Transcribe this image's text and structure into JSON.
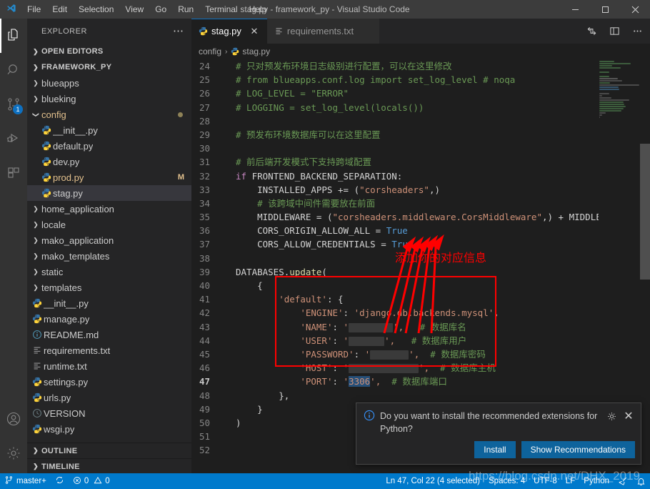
{
  "window": {
    "title": "stag.py - framework_py - Visual Studio Code",
    "minimize": "—",
    "maximize": "☐",
    "close": "✕"
  },
  "menu": {
    "items": [
      "File",
      "Edit",
      "Selection",
      "View",
      "Go",
      "Run",
      "Terminal",
      "Help"
    ]
  },
  "activity_bar": {
    "items": [
      {
        "name": "explorer-icon",
        "badge": ""
      },
      {
        "name": "search-icon",
        "badge": ""
      },
      {
        "name": "source-control-icon",
        "badge": "1"
      },
      {
        "name": "run-debug-icon",
        "badge": ""
      },
      {
        "name": "extensions-icon",
        "badge": ""
      }
    ],
    "bottom_items": [
      {
        "name": "account-icon"
      },
      {
        "name": "settings-gear-icon"
      }
    ]
  },
  "sidebar": {
    "header": "EXPLORER",
    "more_actions": "⋯",
    "sections": [
      {
        "label": "OPEN EDITORS",
        "expanded": false
      },
      {
        "label": "FRAMEWORK_PY",
        "expanded": true
      }
    ],
    "tree": [
      {
        "label": "blueapps",
        "type": "folder",
        "depth": 1,
        "expanded": false
      },
      {
        "label": "blueking",
        "type": "folder",
        "depth": 1,
        "expanded": false
      },
      {
        "label": "config",
        "type": "folder",
        "depth": 1,
        "expanded": true,
        "modified_dot": true
      },
      {
        "label": "__init__.py",
        "type": "python",
        "depth": 2
      },
      {
        "label": "default.py",
        "type": "python",
        "depth": 2
      },
      {
        "label": "dev.py",
        "type": "python",
        "depth": 2
      },
      {
        "label": "prod.py",
        "type": "python",
        "depth": 2,
        "badge": "M",
        "modified": true
      },
      {
        "label": "stag.py",
        "type": "python",
        "depth": 2,
        "selected": true
      },
      {
        "label": "home_application",
        "type": "folder",
        "depth": 1,
        "expanded": false
      },
      {
        "label": "locale",
        "type": "folder",
        "depth": 1,
        "expanded": false
      },
      {
        "label": "mako_application",
        "type": "folder",
        "depth": 1,
        "expanded": false
      },
      {
        "label": "mako_templates",
        "type": "folder",
        "depth": 1,
        "expanded": false
      },
      {
        "label": "static",
        "type": "folder",
        "depth": 1,
        "expanded": false
      },
      {
        "label": "templates",
        "type": "folder",
        "depth": 1,
        "expanded": false
      },
      {
        "label": "__init__.py",
        "type": "python",
        "depth": 1
      },
      {
        "label": "manage.py",
        "type": "python",
        "depth": 1
      },
      {
        "label": "README.md",
        "type": "markdown",
        "depth": 1
      },
      {
        "label": "requirements.txt",
        "type": "text",
        "depth": 1
      },
      {
        "label": "runtime.txt",
        "type": "text",
        "depth": 1
      },
      {
        "label": "settings.py",
        "type": "python",
        "depth": 1
      },
      {
        "label": "urls.py",
        "type": "python",
        "depth": 1
      },
      {
        "label": "VERSION",
        "type": "version",
        "depth": 1
      },
      {
        "label": "wsgi.py",
        "type": "python",
        "depth": 1
      }
    ],
    "footer_sections": [
      {
        "label": "OUTLINE",
        "expanded": false
      },
      {
        "label": "TIMELINE",
        "expanded": false
      }
    ]
  },
  "editor": {
    "tabs": [
      {
        "label": "stag.py",
        "icon": "python-file-icon",
        "active": true,
        "close": "✕"
      },
      {
        "label": "requirements.txt",
        "icon": "text-file-icon",
        "active": false,
        "close": "✕"
      }
    ],
    "tab_actions": [
      "split-editor-icon",
      "layout-icon",
      "more-actions-icon"
    ],
    "breadcrumb": [
      "config",
      "stag.py"
    ],
    "breadcrumb_separator": "›",
    "lines": [
      {
        "n": "24",
        "tokens": [
          {
            "t": "# 只对预发布环境日志级别进行配置，可以在这里修改",
            "c": "c-com"
          }
        ]
      },
      {
        "n": "25",
        "tokens": [
          {
            "t": "# from blueapps.conf.log import set_log_level # noqa",
            "c": "c-com"
          }
        ]
      },
      {
        "n": "26",
        "tokens": [
          {
            "t": "# LOG_LEVEL = \"ERROR\"",
            "c": "c-com"
          }
        ]
      },
      {
        "n": "27",
        "tokens": [
          {
            "t": "# LOGGING = set_log_level(locals())",
            "c": "c-com"
          }
        ]
      },
      {
        "n": "28",
        "tokens": []
      },
      {
        "n": "29",
        "tokens": [
          {
            "t": "# 预发布环境数据库可以在这里配置",
            "c": "c-com"
          }
        ]
      },
      {
        "n": "30",
        "tokens": []
      },
      {
        "n": "31",
        "tokens": [
          {
            "t": "# 前后端开发模式下支持跨域配置",
            "c": "c-com"
          }
        ]
      },
      {
        "n": "32",
        "tokens": [
          {
            "t": "if",
            "c": "c-kw"
          },
          {
            "t": " FRONTEND_BACKEND_SEPARATION:",
            "c": "c-var"
          }
        ]
      },
      {
        "n": "33",
        "tokens": [
          {
            "t": "    INSTALLED_APPS ",
            "c": "c-var"
          },
          {
            "t": "+= (",
            "c": "c-punc"
          },
          {
            "t": "\"corsheaders\"",
            "c": "c-str"
          },
          {
            "t": ",)",
            "c": "c-punc"
          }
        ]
      },
      {
        "n": "34",
        "tokens": [
          {
            "t": "    # 该跨域中间件需要放在前面",
            "c": "c-com"
          }
        ]
      },
      {
        "n": "35",
        "tokens": [
          {
            "t": "    MIDDLEWARE ",
            "c": "c-var"
          },
          {
            "t": "= (",
            "c": "c-punc"
          },
          {
            "t": "\"corsheaders.middleware.CorsMiddleware\"",
            "c": "c-str"
          },
          {
            "t": ",) + MIDDLEWARE",
            "c": "c-punc"
          }
        ]
      },
      {
        "n": "36",
        "tokens": [
          {
            "t": "    CORS_ORIGIN_ALLOW_ALL ",
            "c": "c-var"
          },
          {
            "t": "= ",
            "c": "c-punc"
          },
          {
            "t": "True",
            "c": "c-const"
          }
        ]
      },
      {
        "n": "37",
        "tokens": [
          {
            "t": "    CORS_ALLOW_CREDENTIALS ",
            "c": "c-var"
          },
          {
            "t": "= ",
            "c": "c-punc"
          },
          {
            "t": "True",
            "c": "c-const"
          }
        ]
      },
      {
        "n": "38",
        "tokens": []
      },
      {
        "n": "39",
        "tokens": [
          {
            "t": "DATABASES",
            "c": "c-var"
          },
          {
            "t": ".",
            "c": "c-punc"
          },
          {
            "t": "update",
            "c": "c-fn"
          },
          {
            "t": "(",
            "c": "c-punc"
          }
        ]
      },
      {
        "n": "40",
        "tokens": [
          {
            "t": "    {",
            "c": "c-punc"
          }
        ]
      },
      {
        "n": "41",
        "tokens": [
          {
            "t": "        ",
            "c": "c-punc"
          },
          {
            "t": "'default'",
            "c": "c-str"
          },
          {
            "t": ": {",
            "c": "c-punc"
          }
        ]
      },
      {
        "n": "42",
        "tokens": [
          {
            "t": "            ",
            "c": "c-punc"
          },
          {
            "t": "'ENGINE'",
            "c": "c-str"
          },
          {
            "t": ": ",
            "c": "c-punc"
          },
          {
            "t": "'django.db.backends.mysql'",
            "c": "c-str"
          },
          {
            "t": ",",
            "c": "c-punc"
          }
        ]
      },
      {
        "n": "43",
        "tokens": [
          {
            "t": "            ",
            "c": "c-punc"
          },
          {
            "t": "'NAME'",
            "c": "c-str"
          },
          {
            "t": ": ",
            "c": "c-punc"
          },
          {
            "t": "'",
            "c": "c-str"
          },
          {
            "redact": 62
          },
          {
            "t": "',",
            "c": "c-str"
          },
          {
            "t": "   # 数据库名",
            "c": "c-com"
          }
        ]
      },
      {
        "n": "44",
        "tokens": [
          {
            "t": "            ",
            "c": "c-punc"
          },
          {
            "t": "'USER'",
            "c": "c-str"
          },
          {
            "t": ": ",
            "c": "c-punc"
          },
          {
            "t": "'",
            "c": "c-str"
          },
          {
            "redact": 50
          },
          {
            "t": "',",
            "c": "c-str"
          },
          {
            "t": "   # 数据库用户",
            "c": "c-com"
          }
        ]
      },
      {
        "n": "45",
        "tokens": [
          {
            "t": "            ",
            "c": "c-punc"
          },
          {
            "t": "'PASSWORD'",
            "c": "c-str"
          },
          {
            "t": ": ",
            "c": "c-punc"
          },
          {
            "t": "'",
            "c": "c-str"
          },
          {
            "redact": 54
          },
          {
            "t": "',",
            "c": "c-str"
          },
          {
            "t": "  # 数据库密码",
            "c": "c-com"
          }
        ]
      },
      {
        "n": "46",
        "tokens": [
          {
            "t": "            ",
            "c": "c-punc"
          },
          {
            "t": "'HOST'",
            "c": "c-str"
          },
          {
            "t": ": ",
            "c": "c-punc"
          },
          {
            "t": "'",
            "c": "c-str"
          },
          {
            "redact": 98
          },
          {
            "t": "',",
            "c": "c-str"
          },
          {
            "t": "  # 数据库主机",
            "c": "c-com"
          }
        ]
      },
      {
        "n": "47",
        "tokens": [
          {
            "t": "            ",
            "c": "c-punc"
          },
          {
            "t": "'PORT'",
            "c": "c-str"
          },
          {
            "t": ": ",
            "c": "c-punc"
          },
          {
            "t": "'",
            "c": "c-str"
          },
          {
            "t": "3306",
            "c": "c-str sel-box"
          },
          {
            "t": "',",
            "c": "c-str"
          },
          {
            "t": "  # 数据库端口",
            "c": "c-com"
          }
        ],
        "current": true
      },
      {
        "n": "48",
        "tokens": [
          {
            "t": "        },",
            "c": "c-punc"
          }
        ]
      },
      {
        "n": "49",
        "tokens": [
          {
            "t": "    }",
            "c": "c-punc"
          }
        ]
      },
      {
        "n": "50",
        "tokens": [
          {
            "t": ")",
            "c": "c-punc"
          }
        ]
      },
      {
        "n": "51",
        "tokens": []
      },
      {
        "n": "52",
        "tokens": []
      }
    ],
    "annotation": {
      "text": "添加你的对应信息",
      "color": "#ff0000"
    }
  },
  "notification": {
    "message": "Do you want to install the recommended extensions for Python?",
    "gear": "gear-icon",
    "close": "✕",
    "buttons": [
      {
        "label": "Install",
        "primary": true
      },
      {
        "label": "Show Recommendations",
        "primary": true
      }
    ]
  },
  "statusbar": {
    "branch": "master+",
    "sync": "sync-icon",
    "errors": "0",
    "warnings": "0",
    "position": "Ln 47, Col 22 (4 selected)",
    "indentation": "Spaces: 4",
    "encoding": "UTF-8",
    "eol": "LF",
    "language": "Python",
    "python_status": "python-interpreter-icon",
    "bell": "notifications-bell-icon"
  },
  "watermark": "https://blog.csdn.net/DHX_2019",
  "colors": {
    "accent": "#007acc",
    "button": "#0e639c",
    "annotation": "#ff0000",
    "modified": "#e2c08d",
    "editor_bg": "#1e1e1e",
    "sidebar_bg": "#252526",
    "activity_bg": "#333333",
    "title_bg": "#3c3c3c"
  }
}
